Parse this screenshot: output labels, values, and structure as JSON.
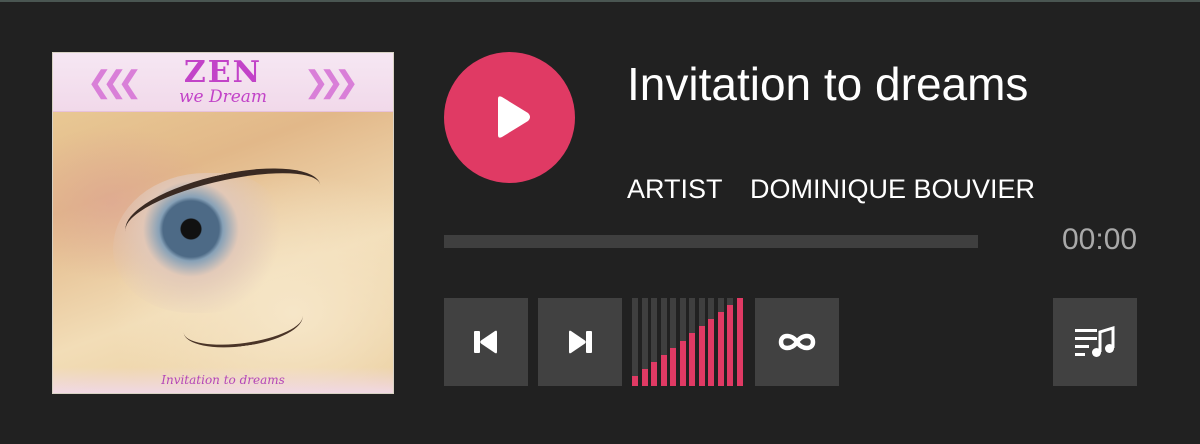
{
  "track": {
    "title": "Invitation to dreams",
    "artist_label": "ARTIST",
    "artist": "DOMINIQUE BOUVIER"
  },
  "cover": {
    "title": "ZEN",
    "subtitle": "we Dream",
    "footer": "Invitation to dreams"
  },
  "player": {
    "time": "00:00",
    "progress": 0,
    "volume_level": 1.0,
    "volume_bars": 12
  },
  "icons": {
    "play": "play-icon",
    "prev": "skip-previous-icon",
    "next": "skip-next-icon",
    "repeat": "infinity-loop-icon",
    "playlist": "playlist-music-icon"
  },
  "colors": {
    "accent": "#e03a64",
    "background": "#212121",
    "control_bg": "#414141",
    "track": "#3f3f3f",
    "time_text": "#a9a9a9"
  }
}
